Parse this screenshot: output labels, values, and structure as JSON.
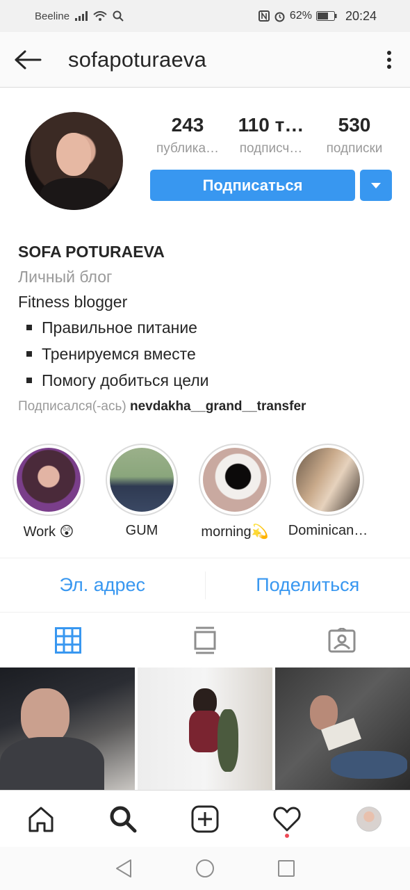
{
  "status_bar": {
    "carrier": "Beeline",
    "battery": "62%",
    "time": "20:24"
  },
  "header": {
    "username": "sofapoturaeva",
    "back_icon": "arrow-left-icon",
    "more_icon": "more-vertical-icon"
  },
  "profile": {
    "stats": [
      {
        "value": "243",
        "label": "публика…"
      },
      {
        "value": "110 т…",
        "label": "подписч…"
      },
      {
        "value": "530",
        "label": "подписки"
      }
    ],
    "follow_label": "Подписаться",
    "dropdown_icon": "triangle-down-icon",
    "accent_color": "#3897f0"
  },
  "bio": {
    "name": "SOFA POTURAEVA",
    "category": "Личный блог",
    "line1": "Fitness blogger",
    "bullets": [
      "Правильное питание",
      "Тренируемся вместе",
      "Помогу добиться цели"
    ],
    "followed_prefix": "Подписался(-ась)",
    "followed_user": "nevdakha__grand__transfer"
  },
  "highlights": [
    {
      "label": "Work 😲"
    },
    {
      "label": "GUM"
    },
    {
      "label": "morning💫"
    },
    {
      "label": "Dominican…"
    }
  ],
  "actions": {
    "email": "Эл. адрес",
    "share": "Поделиться"
  },
  "tabs": [
    "grid-icon",
    "feed-icon",
    "tagged-icon"
  ],
  "bottom_nav": [
    "home-icon",
    "search-icon",
    "add-post-icon",
    "heart-icon",
    "profile-avatar"
  ]
}
